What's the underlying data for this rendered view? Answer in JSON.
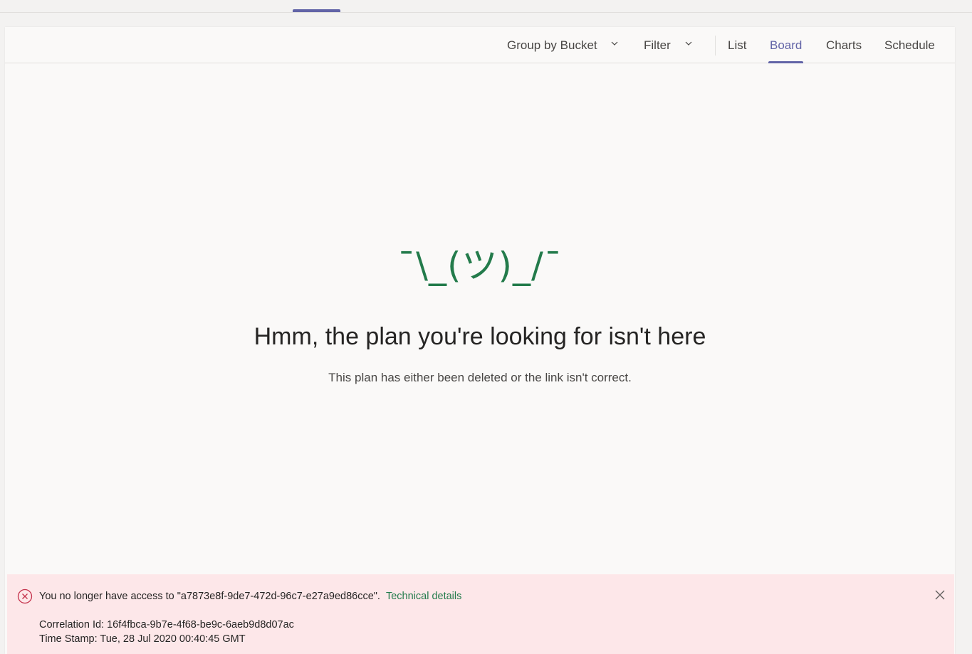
{
  "toolbar": {
    "group_by_label": "Group by Bucket",
    "filter_label": "Filter",
    "views": [
      "List",
      "Board",
      "Charts",
      "Schedule"
    ],
    "active_view": "Board",
    "accent_color": "#6264a7"
  },
  "empty_state": {
    "emoticon": "¯\\_(ツ)_/¯",
    "title": "Hmm, the plan you're looking for isn't here",
    "subtitle": "This plan has either been deleted or the link isn't correct.",
    "emoticon_color": "#237b4b"
  },
  "error": {
    "message": "You no longer have access to \"a7873e8f-9de7-472d-96c7-e27a9ed86cce\".",
    "link_label": "Technical details",
    "correlation": "Correlation Id: 16f4fbca-9b7e-4f68-be9c-6aeb9d8d07ac",
    "timestamp": "Time Stamp: Tue, 28 Jul 2020 00:40:45 GMT",
    "icon": "error-circle-icon",
    "background": "#fde7e9",
    "icon_color": "#c4314b"
  }
}
